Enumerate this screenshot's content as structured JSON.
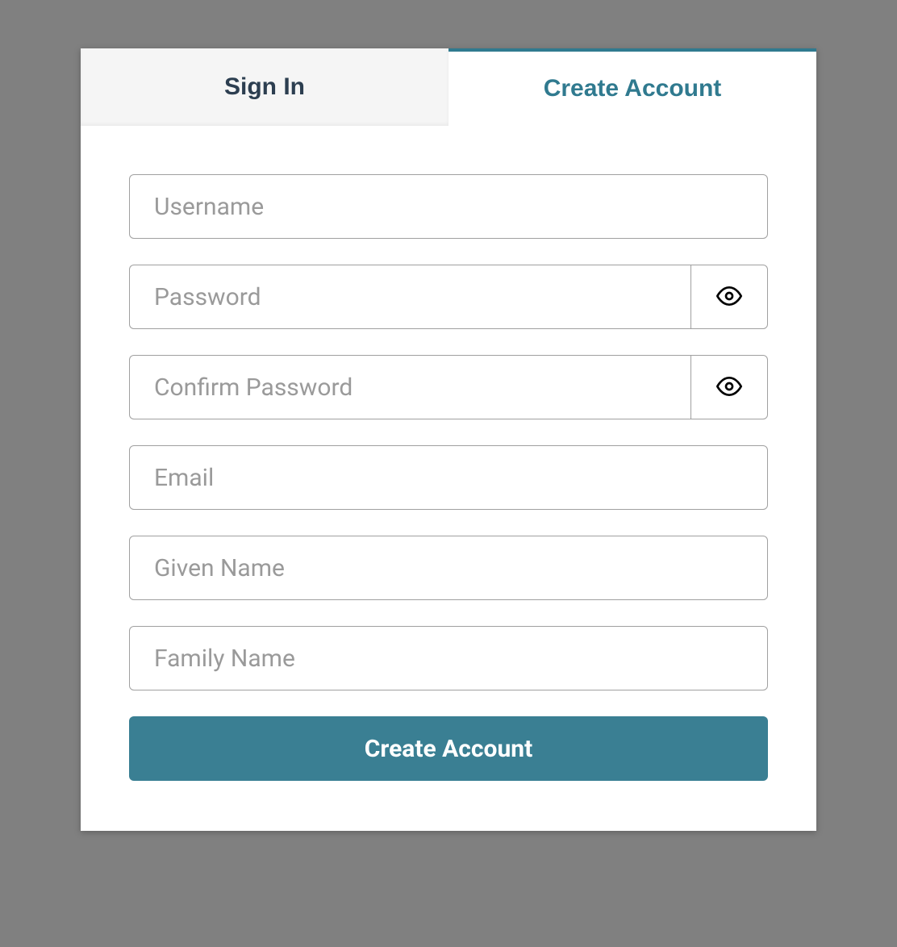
{
  "tabs": {
    "signin_label": "Sign In",
    "create_label": "Create Account"
  },
  "form": {
    "username_placeholder": "Username",
    "password_placeholder": "Password",
    "confirm_password_placeholder": "Confirm Password",
    "email_placeholder": "Email",
    "given_name_placeholder": "Given Name",
    "family_name_placeholder": "Family Name",
    "submit_label": "Create Account"
  },
  "colors": {
    "accent": "#3a7f93",
    "inactive_tab_bg": "#f5f5f5",
    "text_dark": "#2c3e50",
    "placeholder": "#9a9a9a",
    "border": "#a0a0a0"
  }
}
